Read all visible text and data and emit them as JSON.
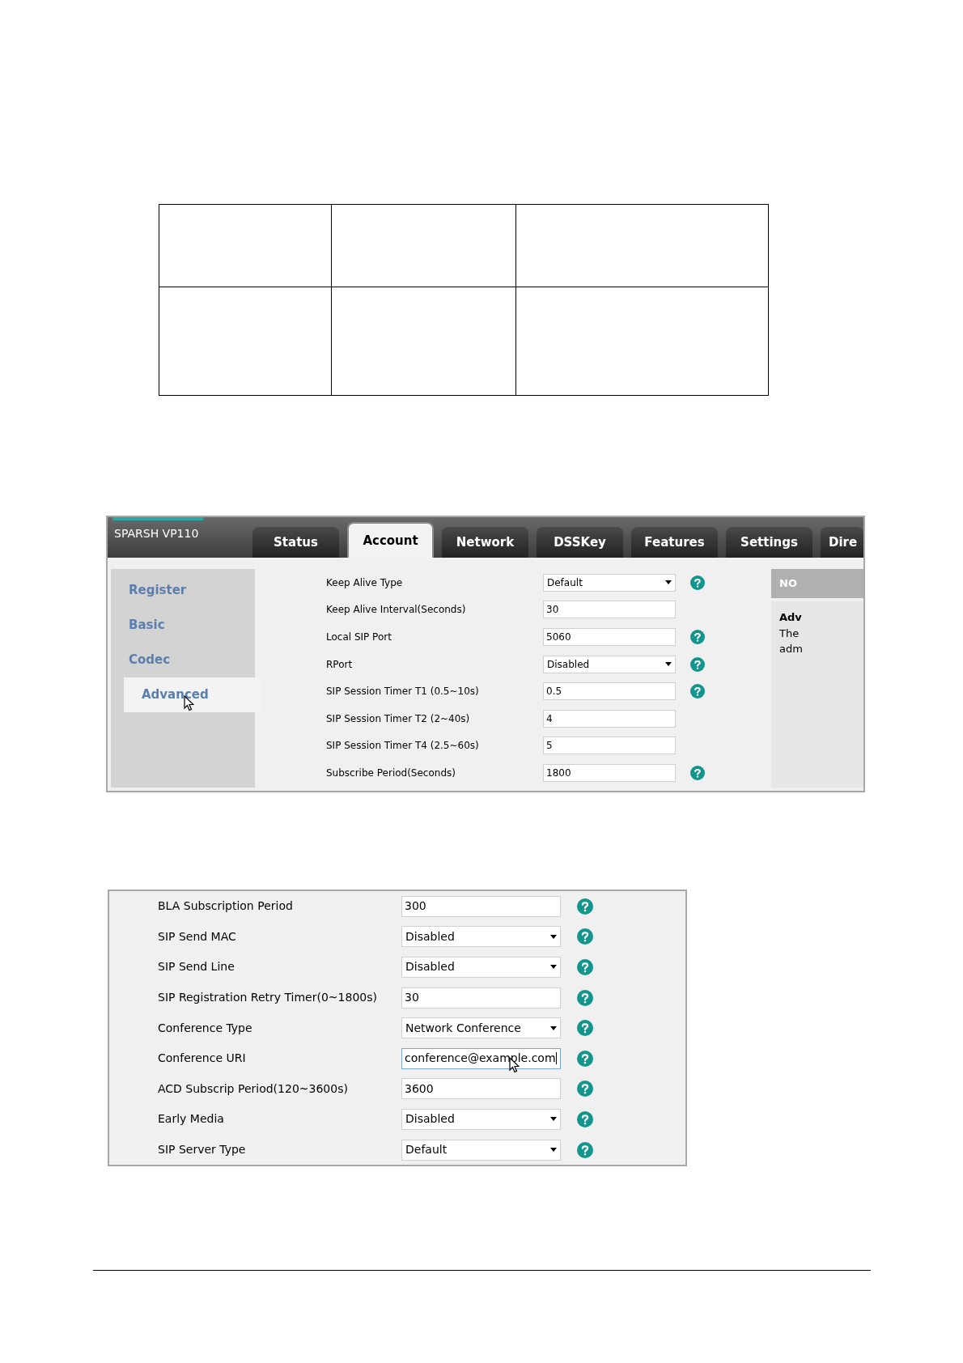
{
  "screenshot_1": {
    "product_name": "SPARSH VP110",
    "tabs": [
      {
        "label": "Status",
        "selected": false
      },
      {
        "label": "Account",
        "selected": true
      },
      {
        "label": "Network",
        "selected": false
      },
      {
        "label": "DSSKey",
        "selected": false
      },
      {
        "label": "Features",
        "selected": false
      },
      {
        "label": "Settings",
        "selected": false
      },
      {
        "label": "Dire",
        "selected": false
      }
    ],
    "sidebar": [
      {
        "label": "Register",
        "selected": false,
        "pointer": false
      },
      {
        "label": "Basic",
        "selected": false,
        "pointer": false
      },
      {
        "label": "Codec",
        "selected": false,
        "pointer": false
      },
      {
        "label": "Advanced",
        "selected": true,
        "pointer": true
      }
    ],
    "fields": [
      {
        "label": "Keep Alive Type",
        "kind": "select",
        "value": "Default",
        "help": true
      },
      {
        "label": "Keep Alive Interval(Seconds)",
        "kind": "input",
        "value": "30",
        "help": false
      },
      {
        "label": "Local SIP Port",
        "kind": "input",
        "value": "5060",
        "help": true
      },
      {
        "label": "RPort",
        "kind": "select",
        "value": "Disabled",
        "help": true
      },
      {
        "label": "SIP Session Timer T1 (0.5~10s)",
        "kind": "input",
        "value": "0.5",
        "help": true
      },
      {
        "label": "SIP Session Timer T2 (2~40s)",
        "kind": "input",
        "value": "4",
        "help": false
      },
      {
        "label": "SIP Session Timer T4 (2.5~60s)",
        "kind": "input",
        "value": "5",
        "help": false
      },
      {
        "label": "Subscribe Period(Seconds)",
        "kind": "input",
        "value": "1800",
        "help": true
      }
    ],
    "notes_panel": {
      "title": "NO",
      "heading": "Adv",
      "lines": [
        "The",
        "adm"
      ]
    }
  },
  "screenshot_2": {
    "fields": [
      {
        "label": "BLA Subscription Period",
        "kind": "input",
        "value": "300",
        "help": true,
        "focused": false,
        "pointer": false
      },
      {
        "label": "SIP Send MAC",
        "kind": "select",
        "value": "Disabled",
        "help": true,
        "focused": false,
        "pointer": false
      },
      {
        "label": "SIP Send Line",
        "kind": "select",
        "value": "Disabled",
        "help": true,
        "focused": false,
        "pointer": false
      },
      {
        "label": "SIP Registration Retry Timer(0~1800s)",
        "kind": "input",
        "value": "30",
        "help": true,
        "focused": false,
        "pointer": false
      },
      {
        "label": "Conference Type",
        "kind": "select",
        "value": "Network Conference",
        "help": true,
        "focused": false,
        "pointer": false
      },
      {
        "label": "Conference URI",
        "kind": "input",
        "value": "conference@example.com",
        "help": true,
        "focused": true,
        "pointer": true
      },
      {
        "label": "ACD Subscrip Period(120~3600s)",
        "kind": "input",
        "value": "3600",
        "help": true,
        "focused": false,
        "pointer": false
      },
      {
        "label": "Early Media",
        "kind": "select",
        "value": "Disabled",
        "help": true,
        "focused": false,
        "pointer": false
      },
      {
        "label": "SIP Server Type",
        "kind": "select",
        "value": "Default",
        "help": true,
        "focused": false,
        "pointer": false
      }
    ]
  }
}
